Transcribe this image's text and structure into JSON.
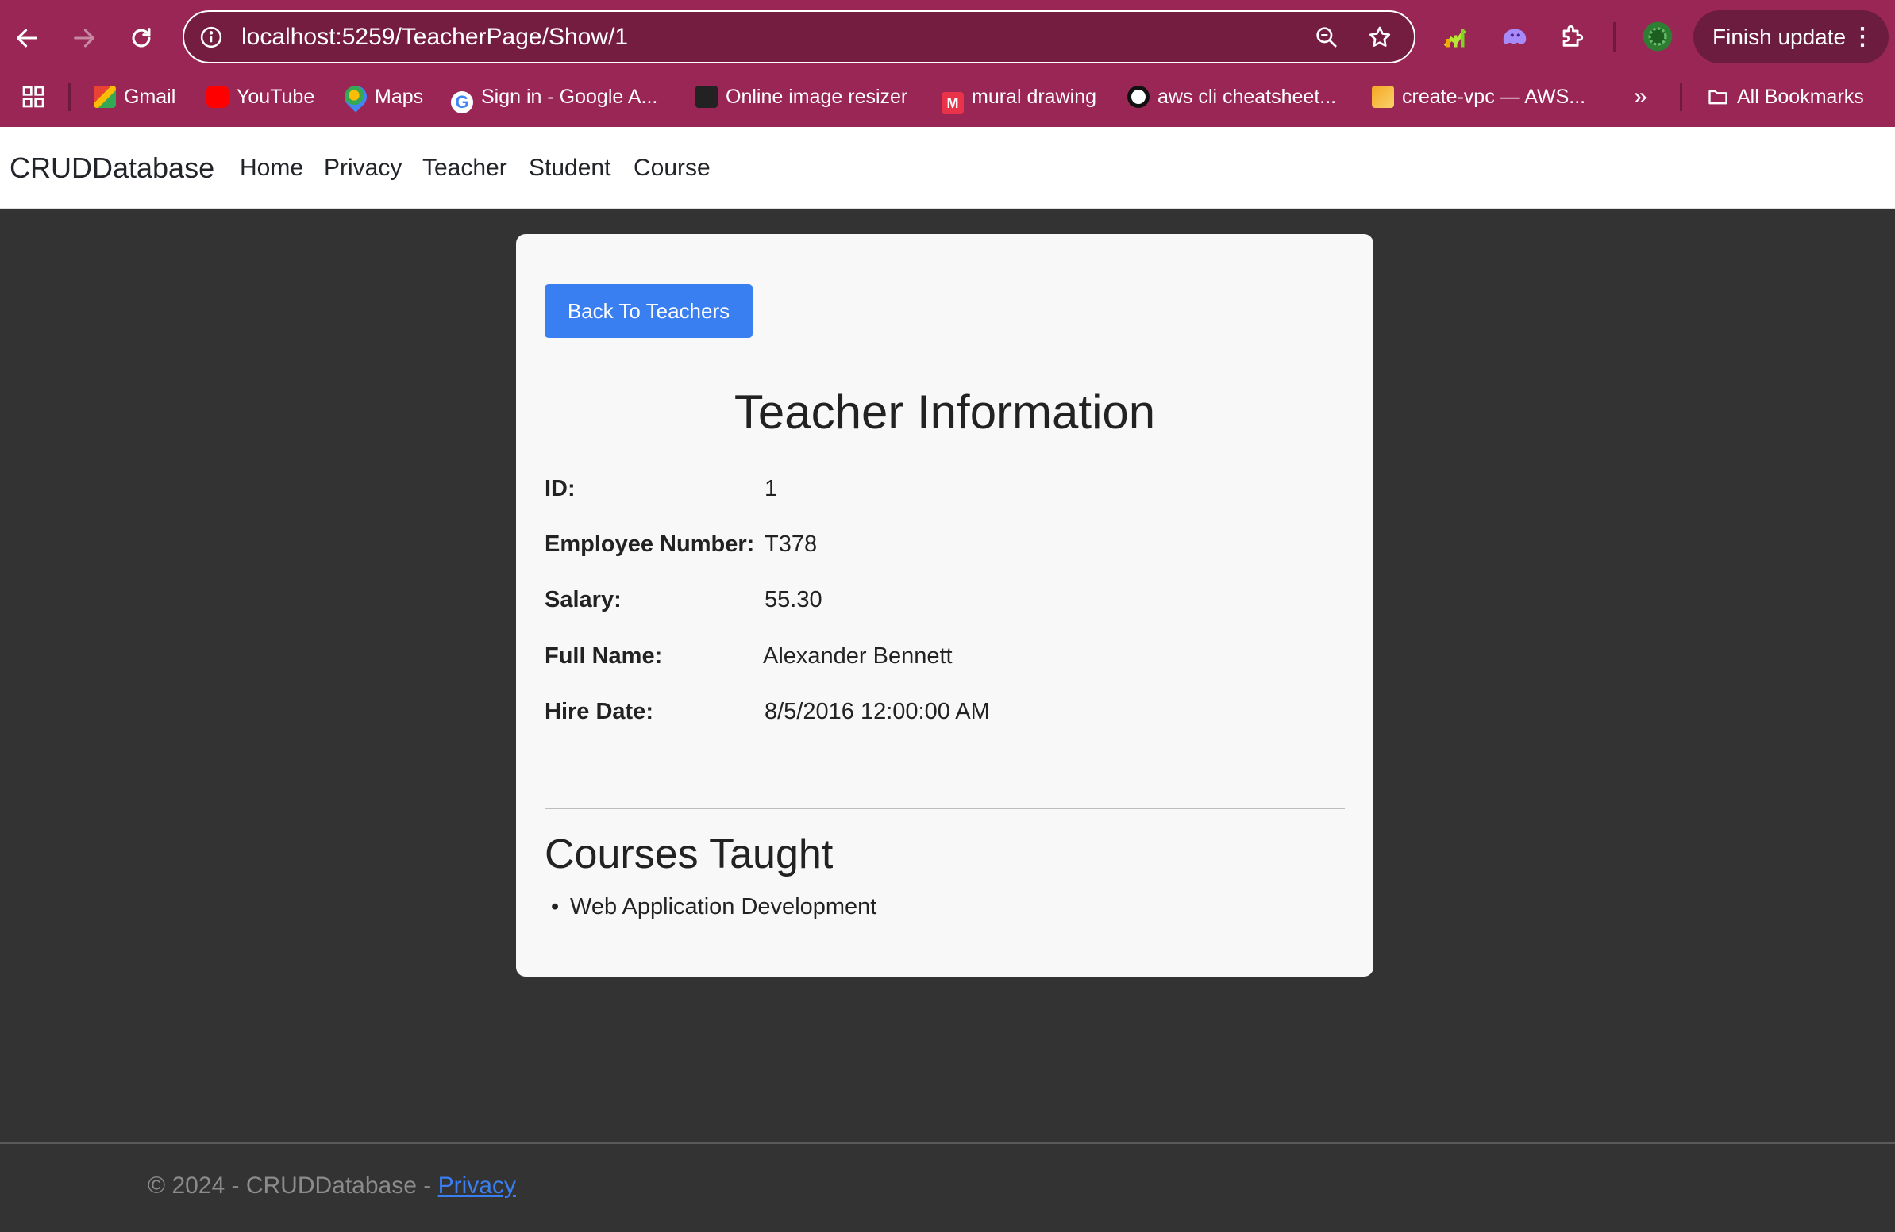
{
  "browser": {
    "url": "localhost:5259/TeacherPage/Show/1",
    "finish_update_label": "Finish update",
    "bookmarks": [
      {
        "label": "Gmail"
      },
      {
        "label": "YouTube"
      },
      {
        "label": "Maps"
      },
      {
        "label": "Sign in - Google A..."
      },
      {
        "label": "Online image resizer"
      },
      {
        "label": "mural drawing"
      },
      {
        "label": "aws cli cheatsheet..."
      },
      {
        "label": "create-vpc — AWS..."
      }
    ],
    "more_bookmarks_label": "»",
    "all_bookmarks_label": "All Bookmarks"
  },
  "site": {
    "brand": "CRUDDatabase",
    "nav": [
      "Home",
      "Privacy",
      "Teacher",
      "Student",
      "Course"
    ]
  },
  "card": {
    "back_label": "Back To Teachers",
    "title": "Teacher Information",
    "fields": [
      {
        "label": "ID:",
        "value": "1"
      },
      {
        "label": "Employee Number:",
        "value": "T378"
      },
      {
        "label": "Salary:",
        "value": "55.30"
      },
      {
        "label": "Full Name:",
        "value": "Alexander Bennett"
      },
      {
        "label": "Hire Date:",
        "value": "8/5/2016 12:00:00 AM"
      }
    ],
    "courses_title": "Courses Taught",
    "courses": [
      "Web Application Development"
    ]
  },
  "footer": {
    "text": "© 2024 - CRUDDatabase - ",
    "link": "Privacy"
  },
  "colors": {
    "chrome": "#9a2655",
    "page_bg": "#333333",
    "primary_button": "#3a7ff2"
  }
}
